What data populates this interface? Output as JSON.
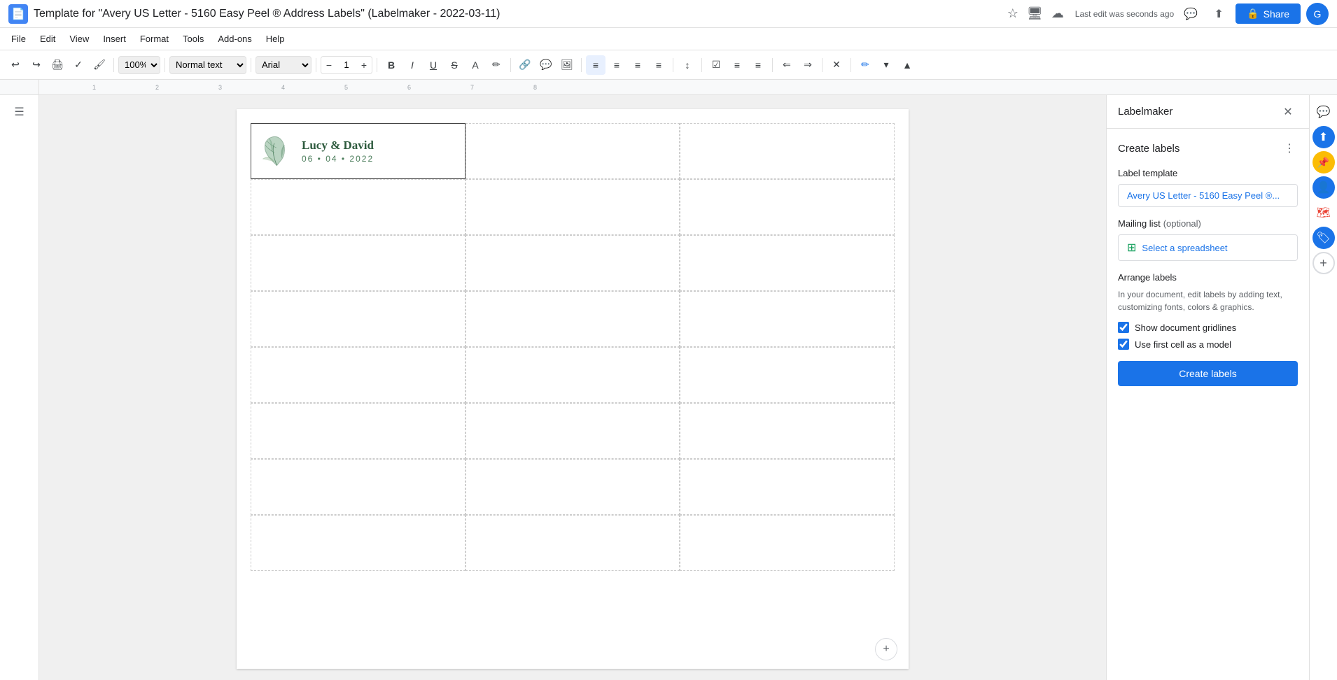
{
  "titleBar": {
    "appIcon": "📄",
    "docTitle": "Template for \"Avery US Letter - 5160 Easy Peel ® Address Labels\" (Labelmaker - 2022-03-11)",
    "lastEdit": "Last edit was seconds ago",
    "shareLabel": "Share"
  },
  "menuBar": {
    "items": [
      "File",
      "Edit",
      "View",
      "Insert",
      "Format",
      "Tools",
      "Add-ons",
      "Help"
    ]
  },
  "toolbar": {
    "zoom": "100%",
    "style": "Normal text",
    "font": "Arial",
    "fontSize": "1"
  },
  "label": {
    "name": "Lucy & David",
    "date": "06 • 04 • 2022"
  },
  "labelmaker": {
    "panelTitle": "Labelmaker",
    "createLabelsTitle": "Create labels",
    "labelTemplateLabel": "Label template",
    "templateValue": "Avery US Letter - 5160 Easy Peel ®...",
    "mailingListLabel": "Mailing list",
    "mailingListOptional": "(optional)",
    "selectSpreadsheetLabel": "Select a spreadsheet",
    "arrangeTitle": "Arrange labels",
    "arrangeDesc": "In your document, edit labels by adding text, customizing fonts, colors & graphics.",
    "checkbox1Label": "Show document gridlines",
    "checkbox2Label": "Use first cell as a model",
    "createBtnLabel": "Create labels"
  },
  "edgeIcons": [
    {
      "name": "chat-icon",
      "symbol": "💬",
      "class": ""
    },
    {
      "name": "save-drive-icon",
      "symbol": "⬆",
      "class": "blue"
    },
    {
      "name": "keep-icon",
      "symbol": "📌",
      "class": "yellow"
    },
    {
      "name": "contacts-icon",
      "symbol": "👤",
      "class": "person"
    },
    {
      "name": "maps-icon",
      "symbol": "🗺",
      "class": "maps"
    },
    {
      "name": "labelmaker-icon",
      "symbol": "🏷",
      "class": "blue2"
    }
  ]
}
